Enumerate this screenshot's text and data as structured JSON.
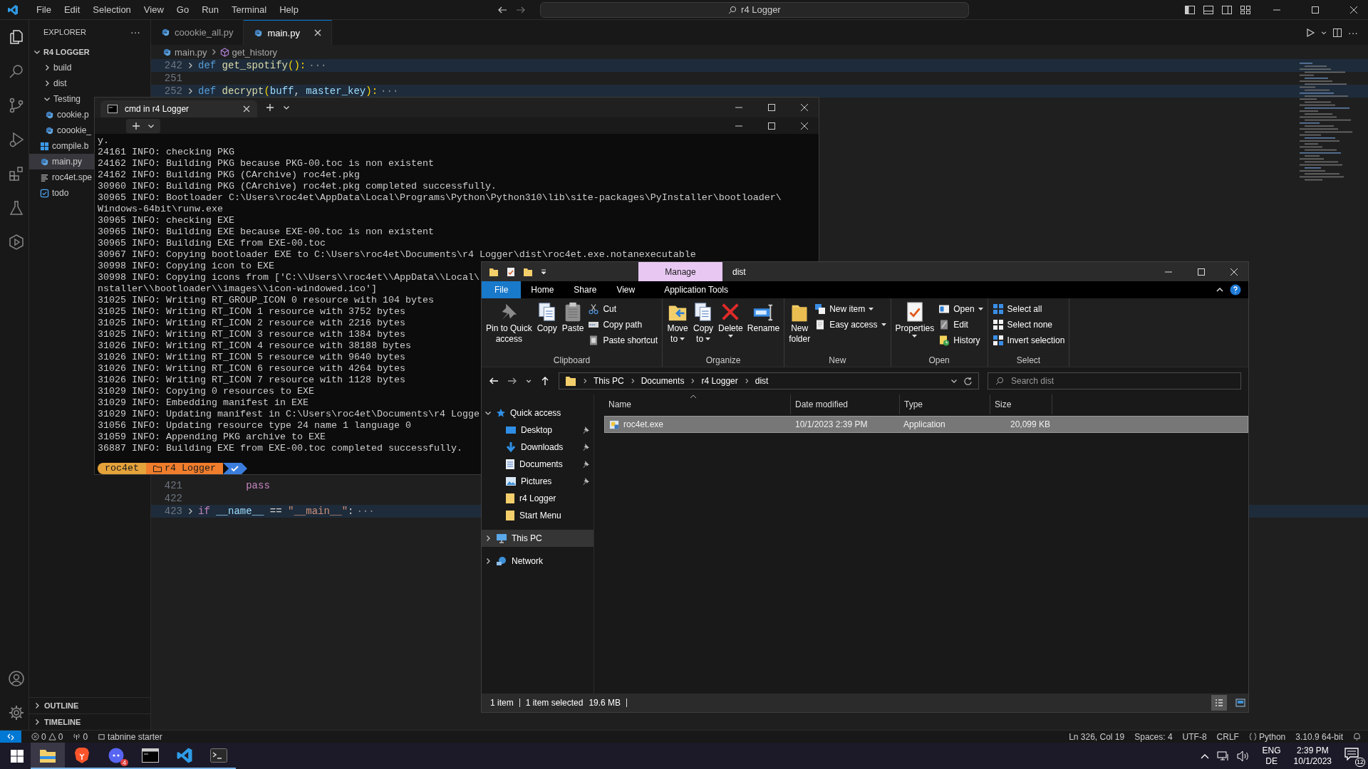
{
  "menu": [
    "File",
    "Edit",
    "Selection",
    "View",
    "Go",
    "Run",
    "Terminal",
    "Help"
  ],
  "command_center": "r4 Logger",
  "explorer_panel": {
    "title": "EXPLORER",
    "more": "···",
    "folder": {
      "label": "R4 LOGGER",
      "expanded": true
    },
    "items": [
      {
        "label": "build",
        "kind": "folder",
        "expanded": false,
        "selected": false
      },
      {
        "label": "dist",
        "kind": "folder",
        "expanded": false,
        "selected": false
      },
      {
        "label": "Testing",
        "kind": "folder",
        "expanded": true,
        "selected": false,
        "children": [
          {
            "label": "cookie.p",
            "kind": "python",
            "selected": false
          },
          {
            "label": "coookie_",
            "kind": "python",
            "selected": false
          }
        ]
      },
      {
        "label": "compile.b",
        "kind": "batch",
        "selected": false
      },
      {
        "label": "main.py",
        "kind": "python",
        "selected": true
      },
      {
        "label": "roc4et.spe",
        "kind": "text",
        "selected": false
      },
      {
        "label": "todo",
        "kind": "todo",
        "selected": false
      }
    ],
    "sections": [
      {
        "label": "OUTLINE",
        "expanded": false
      },
      {
        "label": "TIMELINE",
        "expanded": false
      }
    ]
  },
  "tabs": [
    {
      "label": "coookie_all.py",
      "selected": false
    },
    {
      "label": "main.py",
      "selected": true
    }
  ],
  "breadcrumb": [
    "main.py",
    "get_history"
  ],
  "code_top": [
    {
      "number": "242",
      "folded": true,
      "tokens": [
        {
          "text": "def ",
          "kind": "keyword"
        },
        {
          "text": "get_spotify",
          "kind": "function"
        },
        {
          "text": "():",
          "kind": "bracket"
        }
      ]
    },
    {
      "number": "251",
      "folded": false
    },
    {
      "number": "252",
      "folded": true,
      "tokens": [
        {
          "text": "def ",
          "kind": "keyword"
        },
        {
          "text": "decrypt",
          "kind": "function"
        },
        {
          "text": "(",
          "kind": "bracket"
        },
        {
          "text": "buff",
          "kind": "param"
        },
        {
          "text": ", ",
          "kind": "plain"
        },
        {
          "text": "master_key",
          "kind": "param"
        },
        {
          "text": "):",
          "kind": "bracket"
        }
      ]
    }
  ],
  "code_bottom": [
    {
      "number": "421",
      "folded": false,
      "tokens": [
        {
          "text": "        pass",
          "kind": "control"
        }
      ]
    },
    {
      "number": "422",
      "folded": false
    },
    {
      "number": "423",
      "folded": true,
      "tokens": [
        {
          "text": "if ",
          "kind": "control"
        },
        {
          "text": "__name__",
          "kind": "param"
        },
        {
          "text": " == ",
          "kind": "plain"
        },
        {
          "text": "\"__main__\"",
          "kind": "string"
        },
        {
          "text": ":",
          "kind": "plain"
        }
      ]
    }
  ],
  "fold_marker": "···",
  "terminal": {
    "tab": "cmd in r4 Logger",
    "lines": [
      "y.",
      "24161 INFO: checking PKG",
      "24162 INFO: Building PKG because PKG-00.toc is non existent",
      "24162 INFO: Building PKG (CArchive) roc4et.pkg",
      "30960 INFO: Building PKG (CArchive) roc4et.pkg completed successfully.",
      "30965 INFO: Bootloader C:\\Users\\roc4et\\AppData\\Local\\Programs\\Python\\Python310\\lib\\site-packages\\PyInstaller\\bootloader\\",
      "Windows-64bit\\runw.exe",
      "30965 INFO: checking EXE",
      "30965 INFO: Building EXE because EXE-00.toc is non existent",
      "30965 INFO: Building EXE from EXE-00.toc",
      "30967 INFO: Copying bootloader EXE to C:\\Users\\roc4et\\Documents\\r4 Logger\\dist\\roc4et.exe.notanexecutable",
      "30998 INFO: Copying icon to EXE",
      "30998 INFO: Copying icons from ['C:\\\\Users\\\\roc4et\\\\AppData\\\\Local\\",
      "nstaller\\\\bootloader\\\\images\\\\icon-windowed.ico']",
      "31025 INFO: Writing RT_GROUP_ICON 0 resource with 104 bytes",
      "31025 INFO: Writing RT_ICON 1 resource with 3752 bytes",
      "31025 INFO: Writing RT_ICON 2 resource with 2216 bytes",
      "31025 INFO: Writing RT_ICON 3 resource with 1384 bytes",
      "31026 INFO: Writing RT_ICON 4 resource with 38188 bytes",
      "31026 INFO: Writing RT_ICON 5 resource with 9640 bytes",
      "31026 INFO: Writing RT_ICON 6 resource with 4264 bytes",
      "31026 INFO: Writing RT_ICON 7 resource with 1128 bytes",
      "31029 INFO: Copying 0 resources to EXE",
      "31029 INFO: Embedding manifest in EXE",
      "31029 INFO: Updating manifest in C:\\Users\\roc4et\\Documents\\r4 Logge",
      "31056 INFO: Updating resource type 24 name 1 language 0",
      "31059 INFO: Appending PKG archive to EXE",
      "36887 INFO: Building EXE from EXE-00.toc completed successfully."
    ],
    "prompt": {
      "user": "roc4et",
      "path": "r4 Logger"
    }
  },
  "file_explorer": {
    "context_tab": "Manage",
    "title": "dist",
    "ribbon_tabs": [
      {
        "label": "File",
        "kind": "file"
      },
      {
        "label": "Home",
        "kind": "tab"
      },
      {
        "label": "Share",
        "kind": "tab"
      },
      {
        "label": "View",
        "kind": "tab"
      },
      {
        "label": "Application Tools",
        "kind": "tab"
      }
    ],
    "groups": [
      {
        "label": "Clipboard",
        "commands": [
          {
            "lines": [
              "Pin to Quick",
              "access"
            ],
            "kind": "large",
            "dropdown": false
          },
          {
            "lines": [
              "Copy"
            ],
            "kind": "large",
            "dropdown": false
          },
          {
            "lines": [
              "Paste"
            ],
            "kind": "large",
            "dropdown": false
          },
          {
            "label": "Cut",
            "kind": "small",
            "dropdown": false
          },
          {
            "label": "Copy path",
            "kind": "small",
            "dropdown": false
          },
          {
            "label": "Paste shortcut",
            "kind": "small",
            "dropdown": false
          }
        ]
      },
      {
        "label": "Organize",
        "commands": [
          {
            "lines": [
              "Move",
              "to"
            ],
            "kind": "large",
            "dropdown": true
          },
          {
            "lines": [
              "Copy",
              "to"
            ],
            "kind": "large",
            "dropdown": true
          },
          {
            "lines": [
              "Delete"
            ],
            "kind": "large",
            "dropdown": true
          },
          {
            "lines": [
              "Rename"
            ],
            "kind": "large",
            "dropdown": false
          }
        ]
      },
      {
        "label": "New",
        "commands": [
          {
            "lines": [
              "New",
              "folder"
            ],
            "kind": "large",
            "dropdown": false
          },
          {
            "label": "New item",
            "kind": "small",
            "dropdown": true
          },
          {
            "label": "Easy access",
            "kind": "small",
            "dropdown": true
          }
        ]
      },
      {
        "label": "Open",
        "commands": [
          {
            "lines": [
              "Properties"
            ],
            "kind": "large",
            "dropdown": true
          },
          {
            "label": "Open",
            "kind": "small",
            "dropdown": true
          },
          {
            "label": "Edit",
            "kind": "small",
            "dropdown": false
          },
          {
            "label": "History",
            "kind": "small",
            "dropdown": false
          }
        ]
      },
      {
        "label": "Select",
        "commands": [
          {
            "label": "Select all",
            "kind": "small",
            "dropdown": false
          },
          {
            "label": "Select none",
            "kind": "small",
            "dropdown": false
          },
          {
            "label": "Invert selection",
            "kind": "small",
            "dropdown": false
          }
        ]
      }
    ],
    "address": [
      "This PC",
      "Documents",
      "r4 Logger",
      "dist"
    ],
    "search": {
      "placeholder": "Search dist"
    },
    "nav": [
      {
        "label": "Quick access",
        "expanded": true,
        "selected": false,
        "children": [
          {
            "label": "Desktop",
            "pinned": true,
            "selected": false
          },
          {
            "label": "Downloads",
            "pinned": true,
            "selected": false
          },
          {
            "label": "Documents",
            "pinned": true,
            "selected": false
          },
          {
            "label": "Pictures",
            "pinned": true,
            "selected": false
          },
          {
            "label": "r4 Logger",
            "pinned": false,
            "selected": false
          },
          {
            "label": "Start Menu",
            "pinned": false,
            "selected": false
          }
        ]
      },
      {
        "label": "This PC",
        "expanded": false,
        "selected": true
      },
      {
        "label": "Network",
        "expanded": false,
        "selected": false
      }
    ],
    "columns": [
      {
        "label": "Name",
        "sorted": true
      },
      {
        "label": "Date modified",
        "sorted": false
      },
      {
        "label": "Type",
        "sorted": false
      },
      {
        "label": "Size",
        "sorted": false
      }
    ],
    "rows": [
      {
        "cells": [
          "roc4et.exe",
          "10/1/2023 2:39 PM",
          "Application",
          "20,099 KB"
        ],
        "selected": true
      }
    ],
    "status": {
      "count": "1 item",
      "selection": "1 item selected",
      "size": "19.6 MB"
    },
    "views": [
      {
        "kind": "details",
        "selected": true
      },
      {
        "kind": "tiles",
        "selected": false
      }
    ]
  },
  "status_bar": {
    "errors": "0",
    "warnings": "0",
    "ports": "0",
    "extension": "tabnine starter",
    "right": [
      "Ln 326, Col 19",
      "Spaces: 4",
      "UTF-8",
      "CRLF",
      "Python",
      "3.10.9 64-bit"
    ]
  },
  "taskbar": {
    "apps": [
      {
        "kind": "files",
        "selected": true
      },
      {
        "kind": "browser",
        "selected": false
      },
      {
        "kind": "chat",
        "selected": false,
        "badge": "4"
      },
      {
        "kind": "console",
        "selected": false
      },
      {
        "kind": "editor",
        "selected": false
      },
      {
        "kind": "terminal",
        "selected": false
      }
    ],
    "language": "ENG",
    "layout": "DE",
    "time": "2:39 PM",
    "date": "10/1/2023",
    "notifications": "12"
  }
}
